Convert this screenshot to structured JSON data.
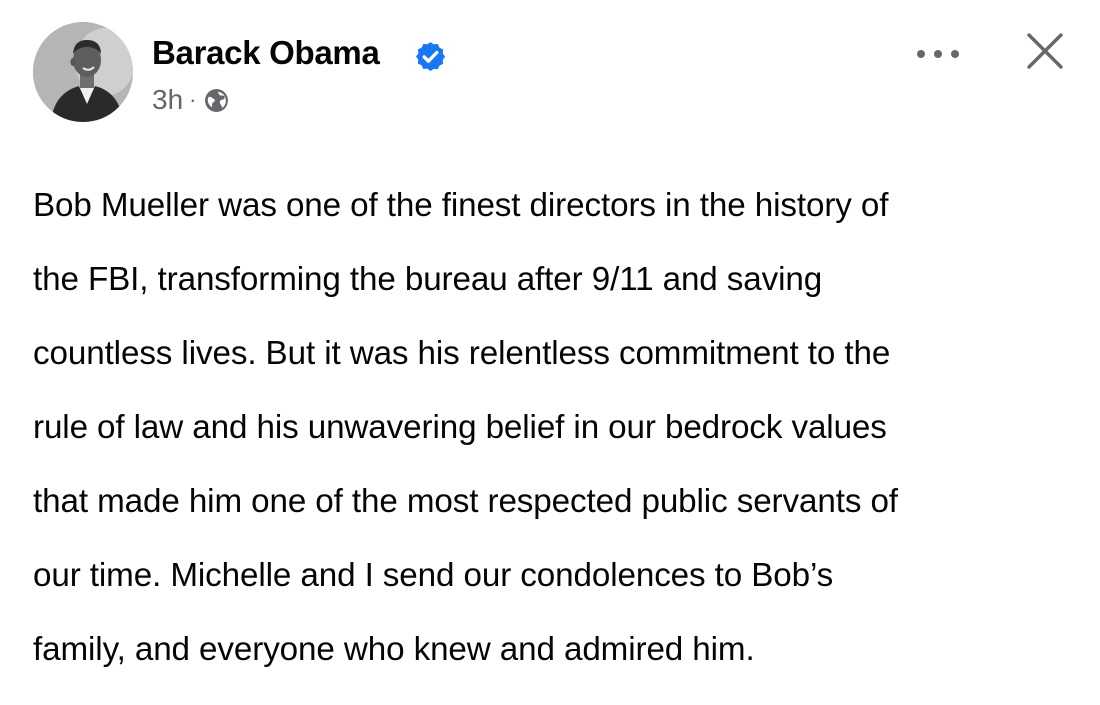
{
  "post": {
    "author": {
      "name": "Barack Obama",
      "verified": true
    },
    "timestamp": "3h",
    "separator": "·",
    "audience_icon": "globe-icon",
    "actions": {
      "more_icon": "more-options-icon",
      "close_icon": "close-icon"
    },
    "text_lines": [
      "Bob Mueller was one of the finest directors in the history of",
      "the FBI, transforming the bureau after 9/11 and saving",
      "countless lives. But it was his relentless commitment to the",
      "rule of law and his unwavering belief in our bedrock values",
      "that made him one of the most respected public servants of",
      "our time. Michelle and I send our condolences to Bob’s",
      "family, and everyone who knew and admired him."
    ]
  },
  "colors": {
    "text": "#050505",
    "secondary_text": "#65676b",
    "verified_badge": "#1877f2",
    "background": "#ffffff"
  }
}
